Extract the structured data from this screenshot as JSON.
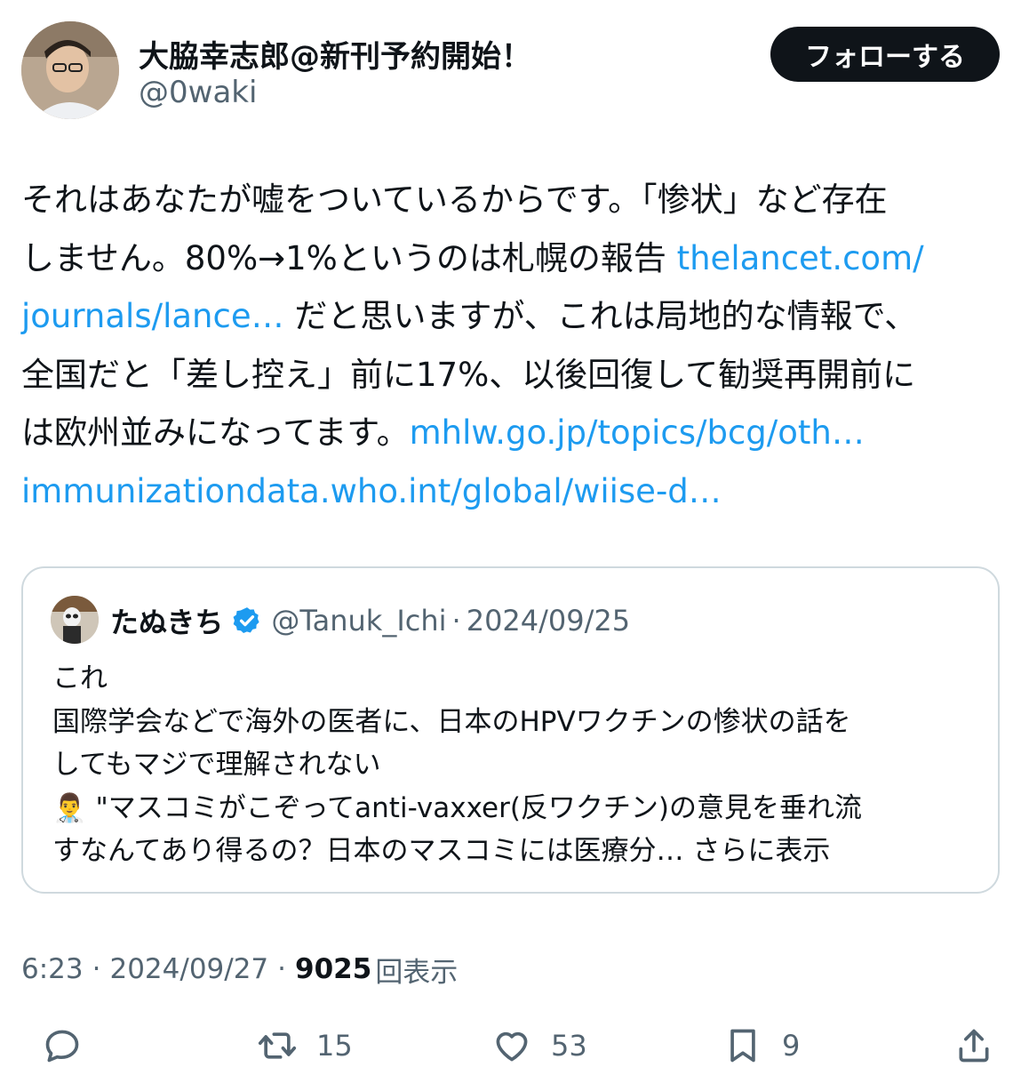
{
  "author": {
    "name": "大脇幸志郎@新刊予約開始！",
    "handle": "@0waki",
    "follow_label": "フォローする"
  },
  "tweet": {
    "lines": [
      [
        {
          "t": "それはあなたが嘘をついているからです。「惨状」など存在"
        }
      ],
      [
        {
          "t": "しません。80%→1%というのは札幌の報告 "
        },
        {
          "t": "thelancet.com/",
          "link": true
        }
      ],
      [
        {
          "t": "journals/lance…",
          "link": true
        },
        {
          "t": " だと思いますが、これは局地的な情報で、"
        }
      ],
      [
        {
          "t": "全国だと「差し控え」前に17%、以後回復して勧奨再開前に"
        }
      ],
      [
        {
          "t": "は欧州並みになってます。"
        },
        {
          "t": "mhlw.go.jp/topics/bcg/oth…",
          "link": true
        }
      ],
      [
        {
          "t": "immunizationdata.who.int/global/wiise-d…",
          "link": true
        }
      ]
    ]
  },
  "quote": {
    "name": "たぬきち",
    "handle": "@Tanuk_Ichi",
    "separator": "·",
    "date": "2024/09/25",
    "lines": [
      "これ",
      "国際学会などで海外の医者に、日本のHPVワクチンの惨状の話を",
      "してもマジで理解されない",
      "👨‍⚕️ \"マスコミがこぞってanti-vaxxer(反ワクチン)の意見を垂れ流"
    ],
    "last_line": "すなんてあり得るの？日本のマスコミには医療分…",
    "show_more": "さらに表示"
  },
  "meta": {
    "time": "6:23",
    "separator": "·",
    "date": "2024/09/27",
    "views": "9025",
    "views_label": "回表示"
  },
  "actions": {
    "reply_icon": "reply-icon",
    "retweet_icon": "retweet-icon",
    "retweets": "15",
    "like_icon": "heart-icon",
    "likes": "53",
    "bookmark_icon": "bookmark-icon",
    "bookmarks": "9",
    "share_icon": "share-icon"
  },
  "colors": {
    "link": "#1d9bf0",
    "secondary_text": "#536471",
    "primary_text": "#0f1419",
    "verified": "#1d9bf0",
    "border": "#cfd9de"
  }
}
